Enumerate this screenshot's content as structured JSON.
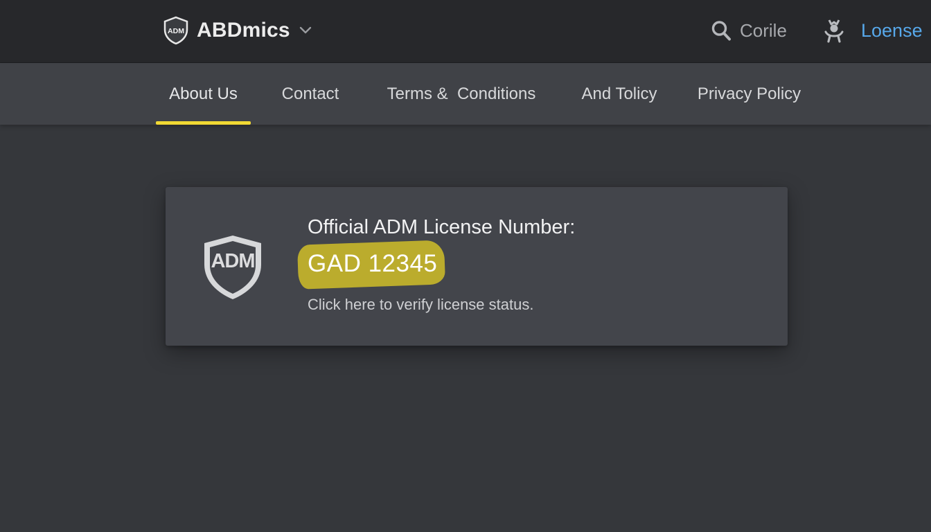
{
  "header": {
    "brand_name": "ABDmics",
    "brand_logo_text": "ADM",
    "search_text": "Corile",
    "user_label": "Loense"
  },
  "nav": {
    "items": [
      {
        "label": "About Us",
        "active": true
      },
      {
        "label": "Contact",
        "active": false
      },
      {
        "label": "Terms &  Conditions",
        "active": false
      },
      {
        "label": "And Tolicy",
        "active": false
      },
      {
        "label": "Privacy Policy",
        "active": false
      }
    ]
  },
  "card": {
    "logo_text": "ADM",
    "title": "Official ADM License Number:",
    "license_number": "GAD 12345",
    "verify_text": "Click here to verify license status."
  },
  "colors": {
    "topbar": "#27282b",
    "navbar": "#404247",
    "page_background": "#35373b",
    "card_background": "#43454b",
    "active_underline": "#f2d934",
    "highlight": "#c5b52a",
    "user_link": "#57a8ea"
  },
  "icons": {
    "brand": "shield-logo-icon",
    "brand_dropdown": "chevron-down-icon",
    "search": "search-icon",
    "user": "user-icon",
    "card": "shield-logo-icon"
  }
}
